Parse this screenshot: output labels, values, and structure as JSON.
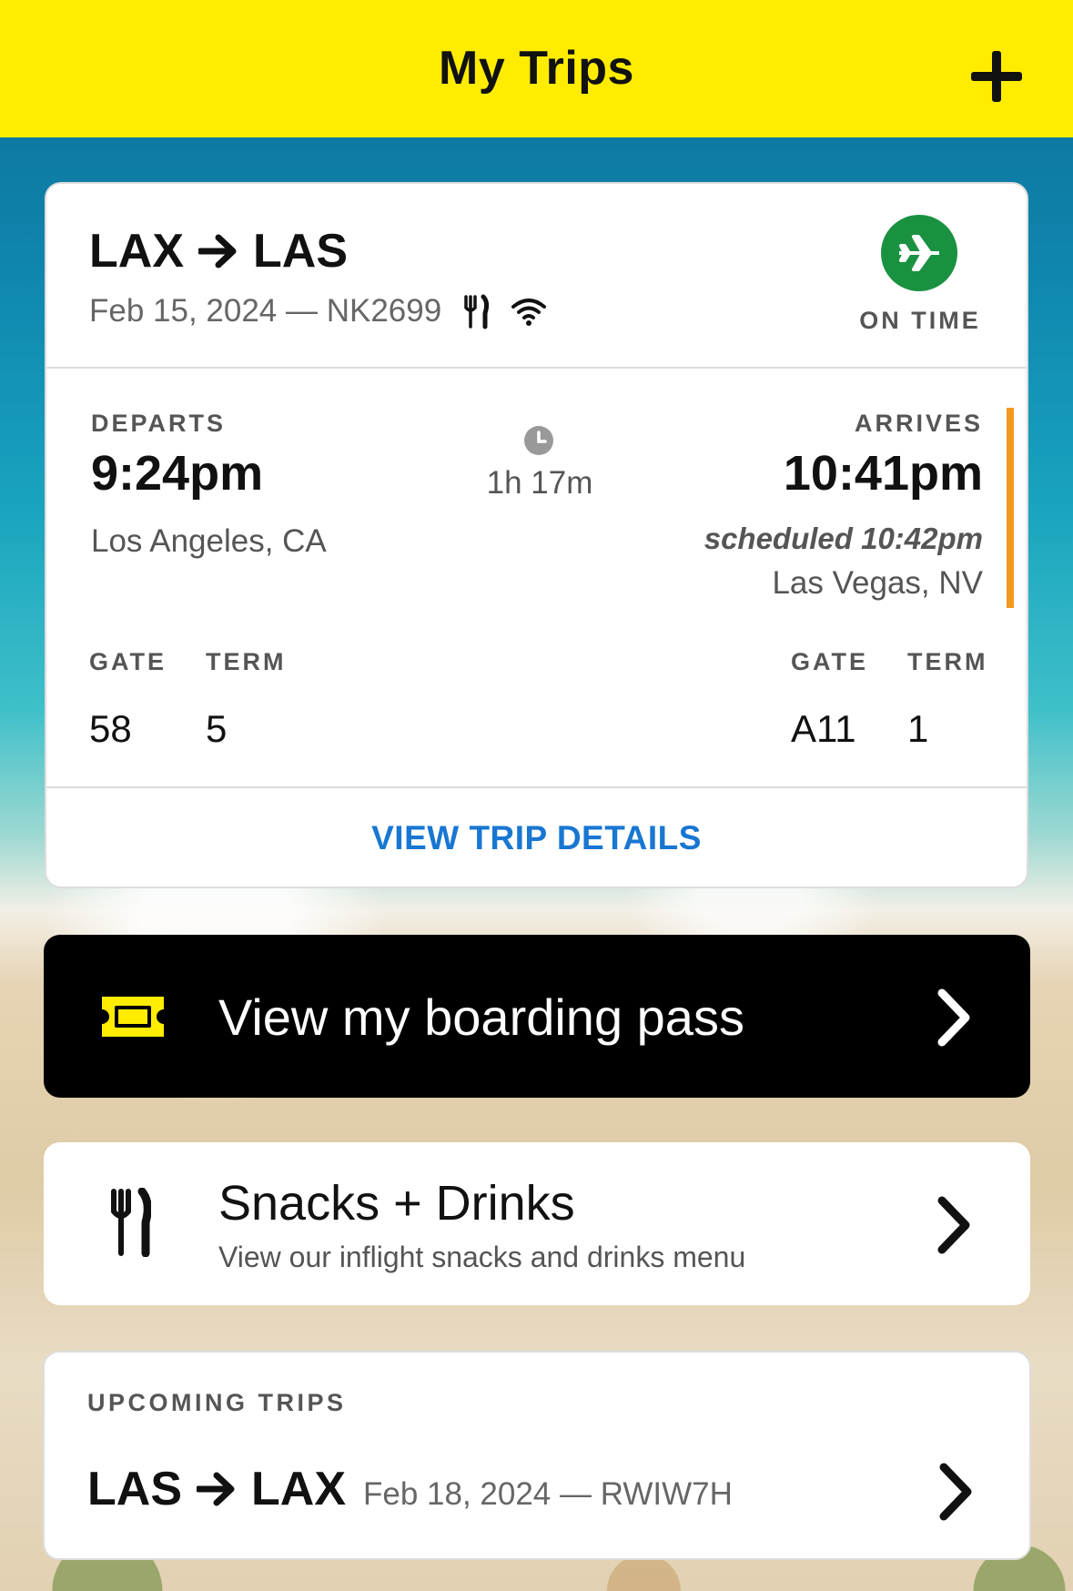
{
  "header": {
    "title": "My Trips"
  },
  "trip": {
    "origin": "LAX",
    "destination": "LAS",
    "date_flight": "Feb 15, 2024 — NK2699",
    "status": "ON TIME",
    "status_color": "#1a9141",
    "departs_label": "DEPARTS",
    "departs_time": "9:24pm",
    "departs_city": "Los Angeles, CA",
    "duration": "1h 17m",
    "arrives_label": "ARRIVES",
    "arrives_time": "10:41pm",
    "arrives_scheduled": "scheduled 10:42pm",
    "arrives_city": "Las Vegas, NV",
    "dep_gate_label": "GATE",
    "dep_term_label": "TERM",
    "dep_gate": "58",
    "dep_term": "5",
    "arr_gate_label": "GATE",
    "arr_term_label": "TERM",
    "arr_gate": "A11",
    "arr_term": "1",
    "details_link": "VIEW TRIP DETAILS",
    "link_color": "#1877d2",
    "delay_indicator_color": "#f39a1e"
  },
  "boarding_pass": {
    "label": "View my boarding pass"
  },
  "snacks": {
    "title": "Snacks + Drinks",
    "subtitle": "View our inflight snacks and drinks menu"
  },
  "upcoming": {
    "section_label": "UPCOMING TRIPS",
    "origin": "LAS",
    "destination": "LAX",
    "date_code": "Feb 18, 2024 — RWIW7H"
  },
  "icons": [
    "add-icon",
    "utensils-icon",
    "wifi-icon",
    "airplane-icon",
    "clock-icon",
    "ticket-icon",
    "chevron-right-icon"
  ],
  "brand_yellow": "#ffec00"
}
